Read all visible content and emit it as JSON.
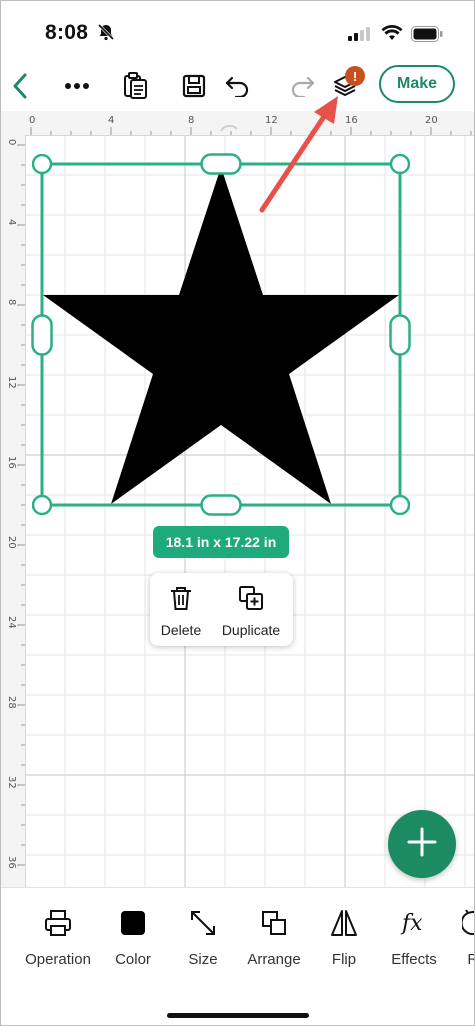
{
  "status_bar": {
    "time": "8:08",
    "icons": [
      "bell-slash-icon",
      "cellular-signal-icon",
      "wifi-icon",
      "battery-icon"
    ]
  },
  "toolbar": {
    "back_icon": "chevron-left-icon",
    "items": [
      "more-icon",
      "clipboard-icon",
      "save-icon",
      "undo-icon",
      "redo-icon",
      "layers-icon"
    ],
    "layers_badge": "!",
    "make_label": "Make"
  },
  "ruler": {
    "top_ticks": [
      "0",
      "4",
      "8",
      "12",
      "16",
      "20"
    ],
    "left_ticks": [
      "0",
      "4",
      "8",
      "12",
      "16",
      "20",
      "24",
      "28",
      "32",
      "36"
    ]
  },
  "selection": {
    "size_label": "18.1 in x 17.22 in"
  },
  "context_menu": {
    "items": [
      {
        "label": "Delete",
        "icon": "trash-icon"
      },
      {
        "label": "Duplicate",
        "icon": "duplicate-icon"
      }
    ]
  },
  "fab": {
    "icon": "plus-icon"
  },
  "bottom_bar": {
    "items": [
      {
        "label": "Operation",
        "icon": "printer-icon"
      },
      {
        "label": "Color",
        "icon": "color-swatch-icon",
        "swatch": "#000000"
      },
      {
        "label": "Size",
        "icon": "resize-icon"
      },
      {
        "label": "Arrange",
        "icon": "arrange-icon"
      },
      {
        "label": "Flip",
        "icon": "flip-icon"
      },
      {
        "label": "Effects",
        "icon": "fx-icon"
      },
      {
        "label": "Ro",
        "icon": "rotate-icon"
      }
    ]
  },
  "colors": {
    "accent": "#1e8a64",
    "selection": "#2bb083",
    "badge": "#c8501e",
    "annotation_arrow": "#e8504a"
  }
}
